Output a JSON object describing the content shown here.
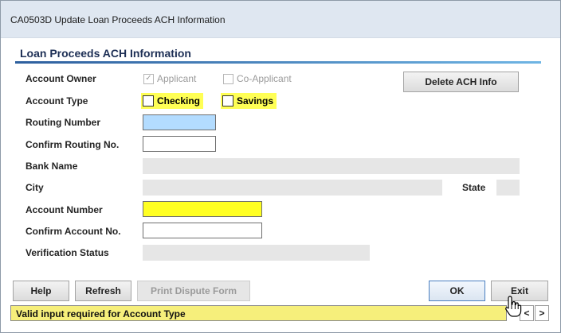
{
  "window": {
    "title": "CA0503D  Update Loan Proceeds ACH Information"
  },
  "section": {
    "title": "Loan Proceeds ACH Information"
  },
  "fields": {
    "account_owner": {
      "label": "Account Owner",
      "applicant": {
        "label": "Applicant",
        "checked": true,
        "enabled": false
      },
      "co_applicant": {
        "label": "Co-Applicant",
        "checked": false,
        "enabled": false
      }
    },
    "account_type": {
      "label": "Account Type",
      "checking": {
        "label": "Checking",
        "checked": false
      },
      "savings": {
        "label": "Savings",
        "checked": false
      }
    },
    "routing_number": {
      "label": "Routing Number",
      "value": ""
    },
    "confirm_routing": {
      "label": "Confirm Routing No.",
      "value": ""
    },
    "bank_name": {
      "label": "Bank Name",
      "value": ""
    },
    "city": {
      "label": "City",
      "value": ""
    },
    "state": {
      "label": "State",
      "value": ""
    },
    "account_number": {
      "label": "Account Number",
      "value": ""
    },
    "confirm_account": {
      "label": "Confirm Account No.",
      "value": ""
    },
    "verification_status": {
      "label": "Verification Status",
      "value": ""
    }
  },
  "buttons": {
    "delete_ach": "Delete ACH Info",
    "help": "Help",
    "refresh": "Refresh",
    "print_dispute": "Print Dispute Form",
    "ok": "OK",
    "exit": "Exit"
  },
  "status": {
    "message": "Valid input required for Account Type"
  },
  "nav": {
    "prev": "<",
    "next": ">"
  },
  "icons": {
    "check": "check-icon",
    "cursor": "hand-pointer-icon"
  },
  "colors": {
    "required_highlight": "#ffff22",
    "focus_field": "#b3dcff",
    "status_background": "#f6ef7b",
    "section_rule": "#2e5f9e"
  }
}
